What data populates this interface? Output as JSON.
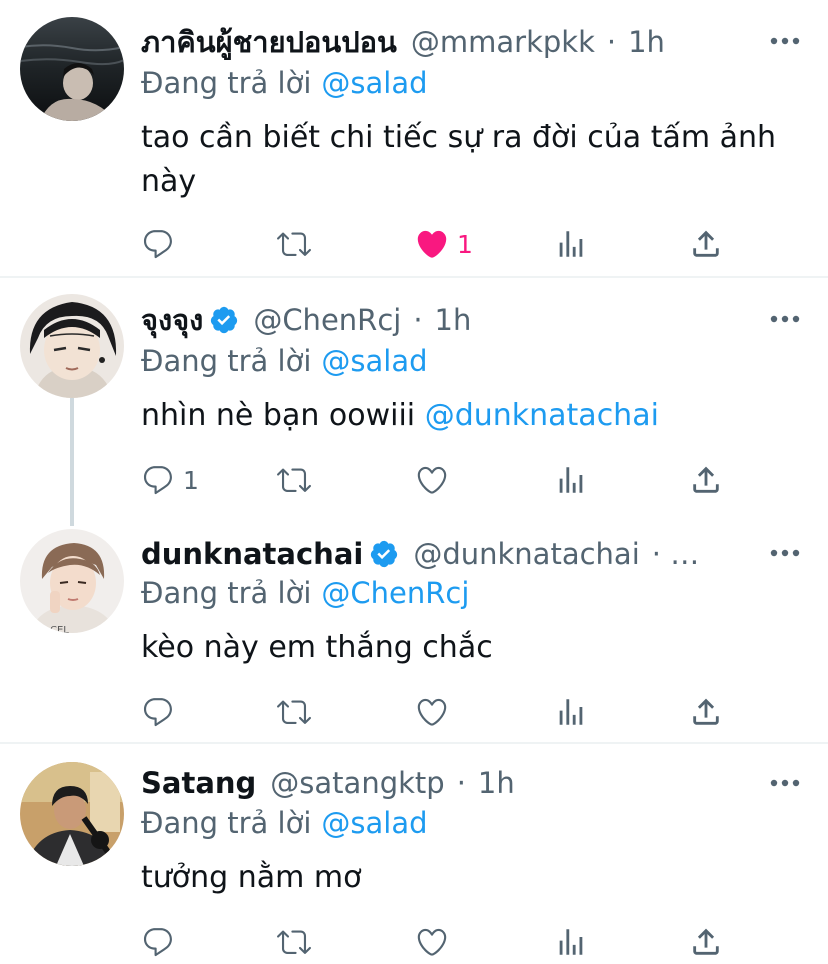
{
  "colors": {
    "link": "#1d9bf0",
    "muted": "#536471",
    "like": "#f91880",
    "divider": "#eff3f4"
  },
  "tweets": [
    {
      "name": "ภาคินผู้ชายปอนปอน",
      "handle": "@mmarkpkk",
      "dot": "·",
      "time": "1h",
      "reply_label": "Đang trả lời",
      "reply_to": "@salad",
      "text": "tao cần biết chi tiếc sự ra đời của tấm ảnh này",
      "reply_count": "",
      "like_count": "1",
      "liked": true
    },
    {
      "name": "จุงจุง",
      "handle": "@ChenRcj",
      "dot": "·",
      "time": "1h",
      "verified": true,
      "reply_label": "Đang trả lời",
      "reply_to": "@salad",
      "text_before": "nhìn nè bạn oowiii",
      "text_mention": "@dunknatachai",
      "reply_count": "1",
      "like_count": ""
    },
    {
      "name": "dunknatachai",
      "handle": "@dunknatachai",
      "dot": "· …",
      "time": "",
      "verified": true,
      "reply_label": "Đang trả lời",
      "reply_to": "@ChenRcj",
      "text": "kèo này em thắng chắc",
      "reply_count": "",
      "like_count": ""
    },
    {
      "name": "Satang",
      "handle": "@satangktp",
      "dot": "·",
      "time": "1h",
      "reply_label": "Đang trả lời",
      "reply_to": "@salad",
      "text": "tưởng nằm mơ",
      "reply_count": "",
      "like_count": ""
    }
  ],
  "icons": [
    "reply-icon",
    "retweet-icon",
    "like-icon",
    "analytics-icon",
    "share-icon",
    "more-icon",
    "verified-badge-icon"
  ]
}
